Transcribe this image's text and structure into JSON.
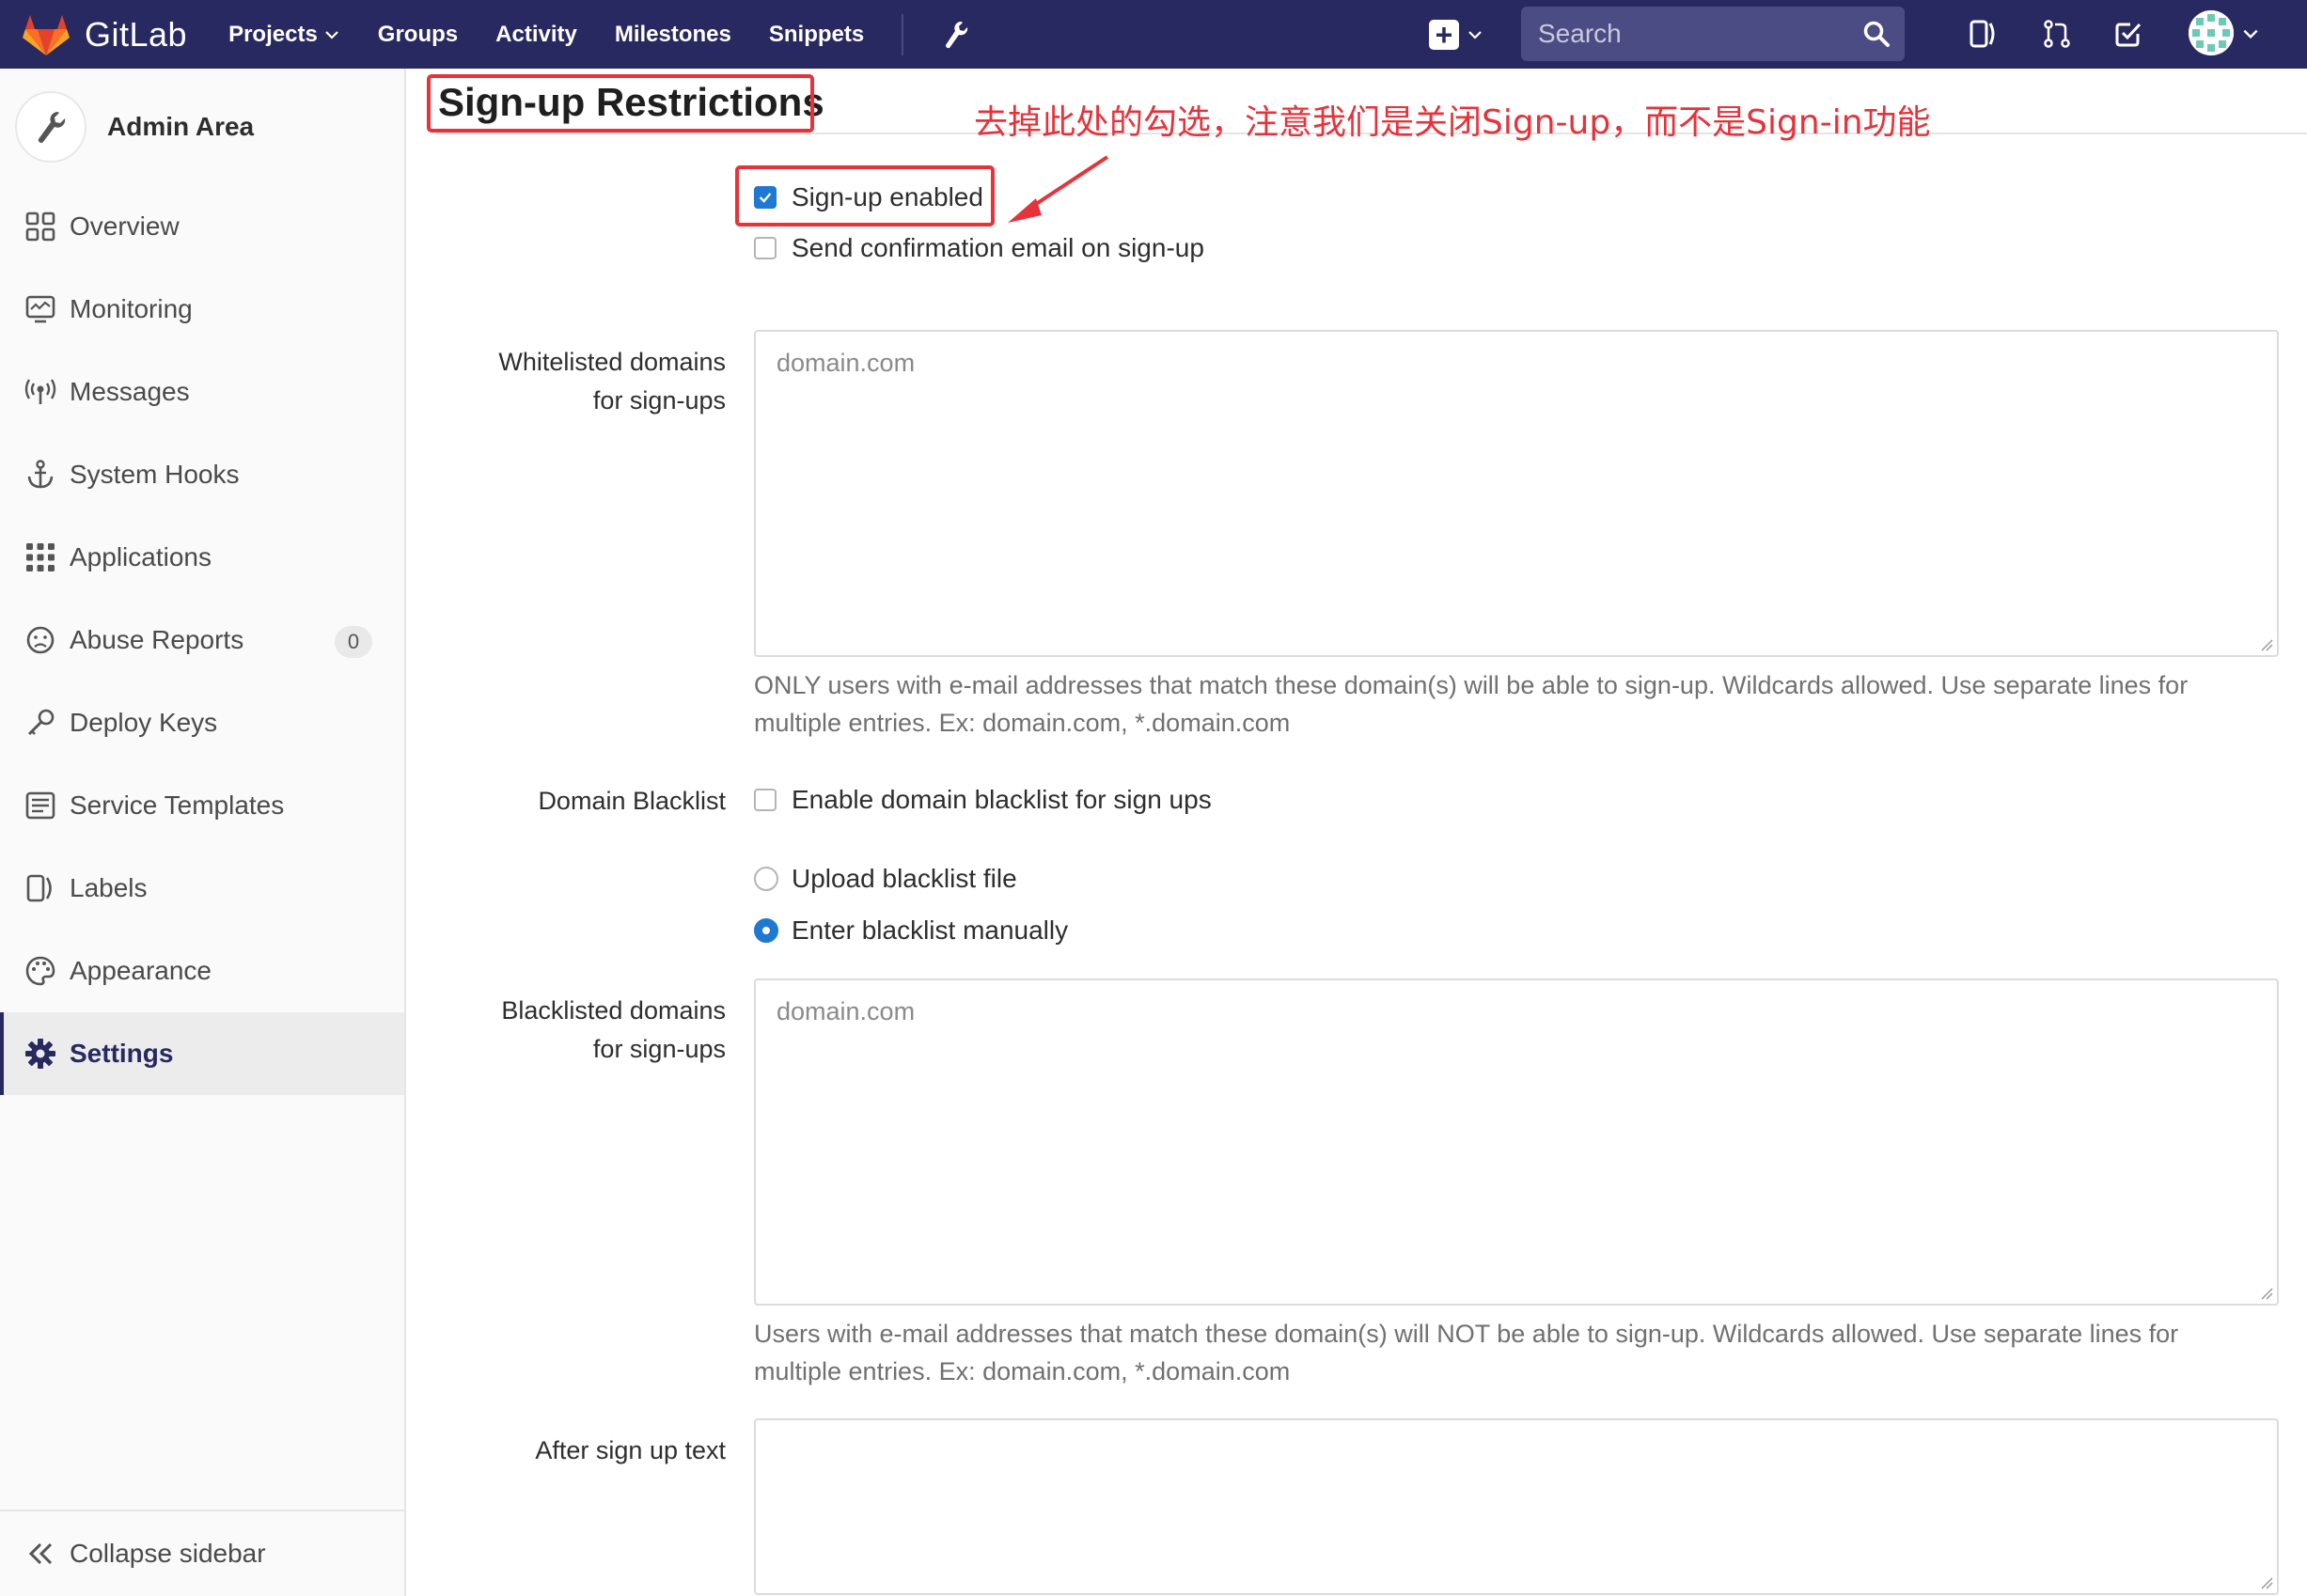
{
  "navbar": {
    "brand": "GitLab",
    "links": [
      "Projects",
      "Groups",
      "Activity",
      "Milestones",
      "Snippets"
    ],
    "search_placeholder": "Search"
  },
  "sidebar": {
    "title": "Admin Area",
    "items": [
      {
        "label": "Overview",
        "icon": "overview-icon"
      },
      {
        "label": "Monitoring",
        "icon": "monitoring-icon"
      },
      {
        "label": "Messages",
        "icon": "messages-icon"
      },
      {
        "label": "System Hooks",
        "icon": "anchor-icon"
      },
      {
        "label": "Applications",
        "icon": "applications-icon"
      },
      {
        "label": "Abuse Reports",
        "icon": "abuse-icon",
        "badge": "0"
      },
      {
        "label": "Deploy Keys",
        "icon": "key-icon"
      },
      {
        "label": "Service Templates",
        "icon": "templates-icon"
      },
      {
        "label": "Labels",
        "icon": "label-icon"
      },
      {
        "label": "Appearance",
        "icon": "palette-icon"
      },
      {
        "label": "Settings",
        "icon": "gear-icon",
        "active": true
      }
    ],
    "collapse_label": "Collapse sidebar"
  },
  "content": {
    "section_title": "Sign-up Restrictions",
    "annotation": "去掉此处的勾选，注意我们是关闭Sign-up，而不是Sign-in功能",
    "signup_enabled": {
      "label": "Sign-up enabled",
      "checked": true
    },
    "send_confirmation": {
      "label": "Send confirmation email on sign-up",
      "checked": false
    },
    "whitelist": {
      "label_line1": "Whitelisted domains",
      "label_line2": "for sign-ups",
      "placeholder": "domain.com",
      "help_line1": "ONLY users with e-mail addresses that match these domain(s) will be able to sign-up. Wildcards allowed. Use separate lines for",
      "help_line2": "multiple entries. Ex: domain.com, *.domain.com"
    },
    "domain_blacklist": {
      "label": "Domain Blacklist",
      "enable_label": "Enable domain blacklist for sign ups",
      "enable_checked": false,
      "upload_label": "Upload blacklist file",
      "manual_label": "Enter blacklist manually",
      "selected": "manual"
    },
    "blacklist": {
      "label_line1": "Blacklisted domains",
      "label_line2": "for sign-ups",
      "placeholder": "domain.com",
      "help_line1": "Users with e-mail addresses that match these domain(s) will NOT be able to sign-up. Wildcards allowed. Use separate lines for",
      "help_line2": "multiple entries. Ex: domain.com, *.domain.com"
    },
    "after_signup": {
      "label": "After sign up text",
      "value": ""
    }
  },
  "colors": {
    "navbar": "#292961",
    "accent": "#1f78d1",
    "annotation_red": "#e8323a"
  }
}
